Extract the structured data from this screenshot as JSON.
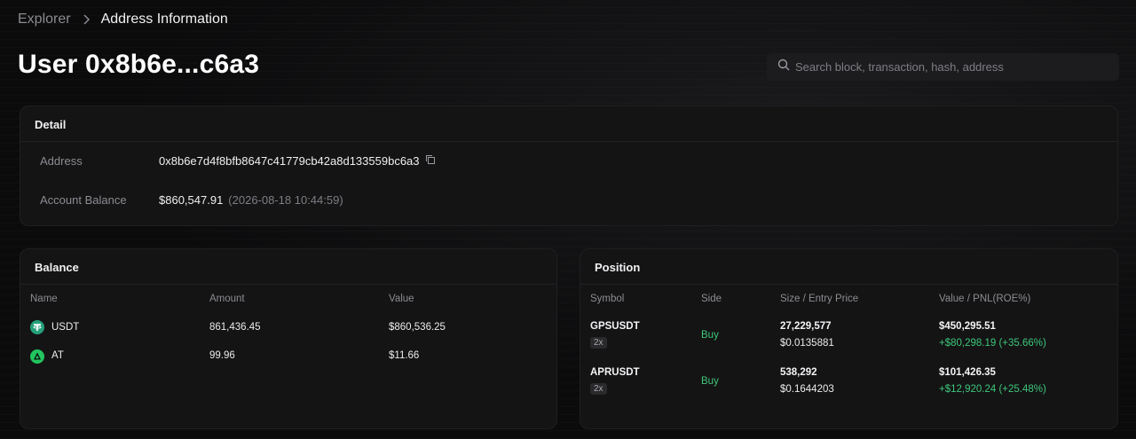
{
  "breadcrumb": {
    "root": "Explorer",
    "current": "Address Information"
  },
  "page_title": "User 0x8b6e...c6a3",
  "search": {
    "placeholder": "Search block, transaction, hash, address"
  },
  "detail": {
    "title": "Detail",
    "address_label": "Address",
    "address_value": "0x8b6e7d4f8bfb8647c41779cb42a8d133559bc6a3",
    "balance_label": "Account Balance",
    "balance_value": "$860,547.91",
    "balance_timestamp": "(2026-08-18 10:44:59)"
  },
  "balance": {
    "title": "Balance",
    "columns": [
      "Name",
      "Amount",
      "Value"
    ],
    "rows": [
      {
        "name": "USDT",
        "amount": "861,436.45",
        "value": "$860,536.25",
        "icon": "tether-icon",
        "color": "#26a17b"
      },
      {
        "name": "AT",
        "amount": "99.96",
        "value": "$11.66",
        "icon": "at-token-icon",
        "color": "#22c55e"
      }
    ]
  },
  "position": {
    "title": "Position",
    "columns": [
      "Symbol",
      "Side",
      "Size / Entry Price",
      "Value / PNL(ROE%)"
    ],
    "rows": [
      {
        "symbol": "GPSUSDT",
        "leverage": "2x",
        "side": "Buy",
        "size": "27,229,577",
        "entry": "$0.0135881",
        "value": "$450,295.51",
        "pnl": "+$80,298.19 (+35.66%)"
      },
      {
        "symbol": "APRUSDT",
        "leverage": "2x",
        "side": "Buy",
        "size": "538,292",
        "entry": "$0.1644203",
        "value": "$101,426.35",
        "pnl": "+$12,920.24 (+25.48%)"
      }
    ]
  },
  "colors": {
    "accent_green": "#3ec77a",
    "background": "#0b0b0c",
    "card": "#141415"
  }
}
